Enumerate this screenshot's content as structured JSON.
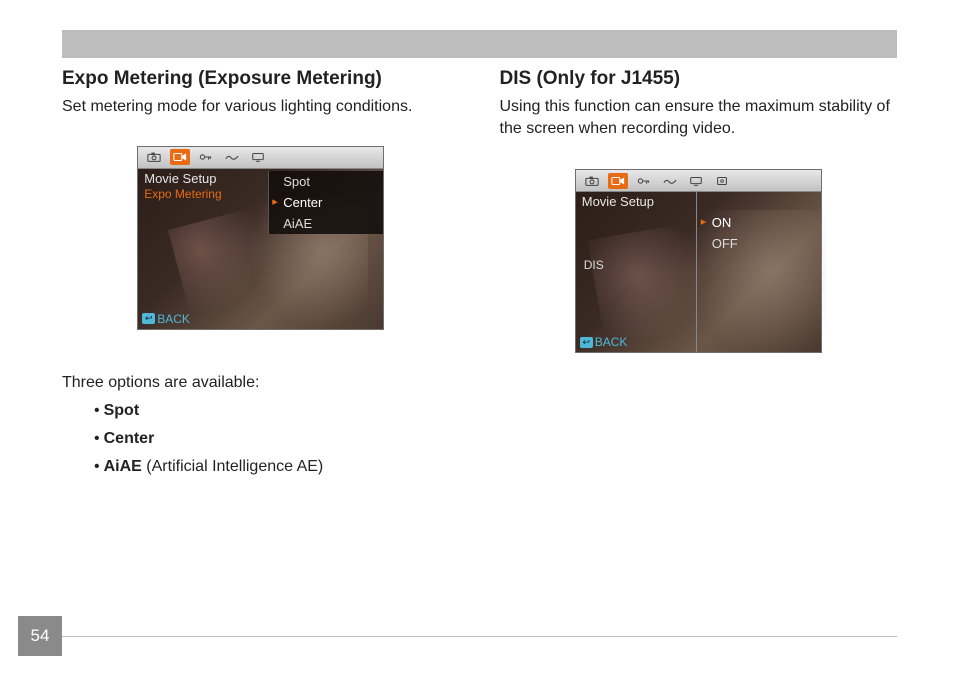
{
  "page_number": "54",
  "left": {
    "title": "Expo Metering (Exposure Metering)",
    "desc": "Set metering mode for various lighting conditions.",
    "camera": {
      "subtitle": "Movie Setup",
      "setting_name": "Expo Metering",
      "options": [
        "Spot",
        "Center",
        "AiAE"
      ],
      "selected_index": 1,
      "back_label": "BACK"
    },
    "options_intro": "Three options are available:",
    "options_list": [
      {
        "name": "Spot",
        "note": ""
      },
      {
        "name": "Center",
        "note": ""
      },
      {
        "name": "AiAE",
        "note": " (Artificial Intelligence AE)"
      }
    ]
  },
  "right": {
    "title": "DIS (Only for J1455)",
    "desc": "Using this function can ensure the maximum stability of the screen when recording video.",
    "camera": {
      "subtitle": "Movie Setup",
      "side_label": "DIS",
      "options": [
        "ON",
        "OFF"
      ],
      "selected_index": 0,
      "back_label": "BACK"
    }
  },
  "colors": {
    "accent": "#e86a12",
    "back_link": "#4fb8d8",
    "header_bar": "#bdbdbd",
    "pagenum_bg": "#8a8a8a"
  }
}
